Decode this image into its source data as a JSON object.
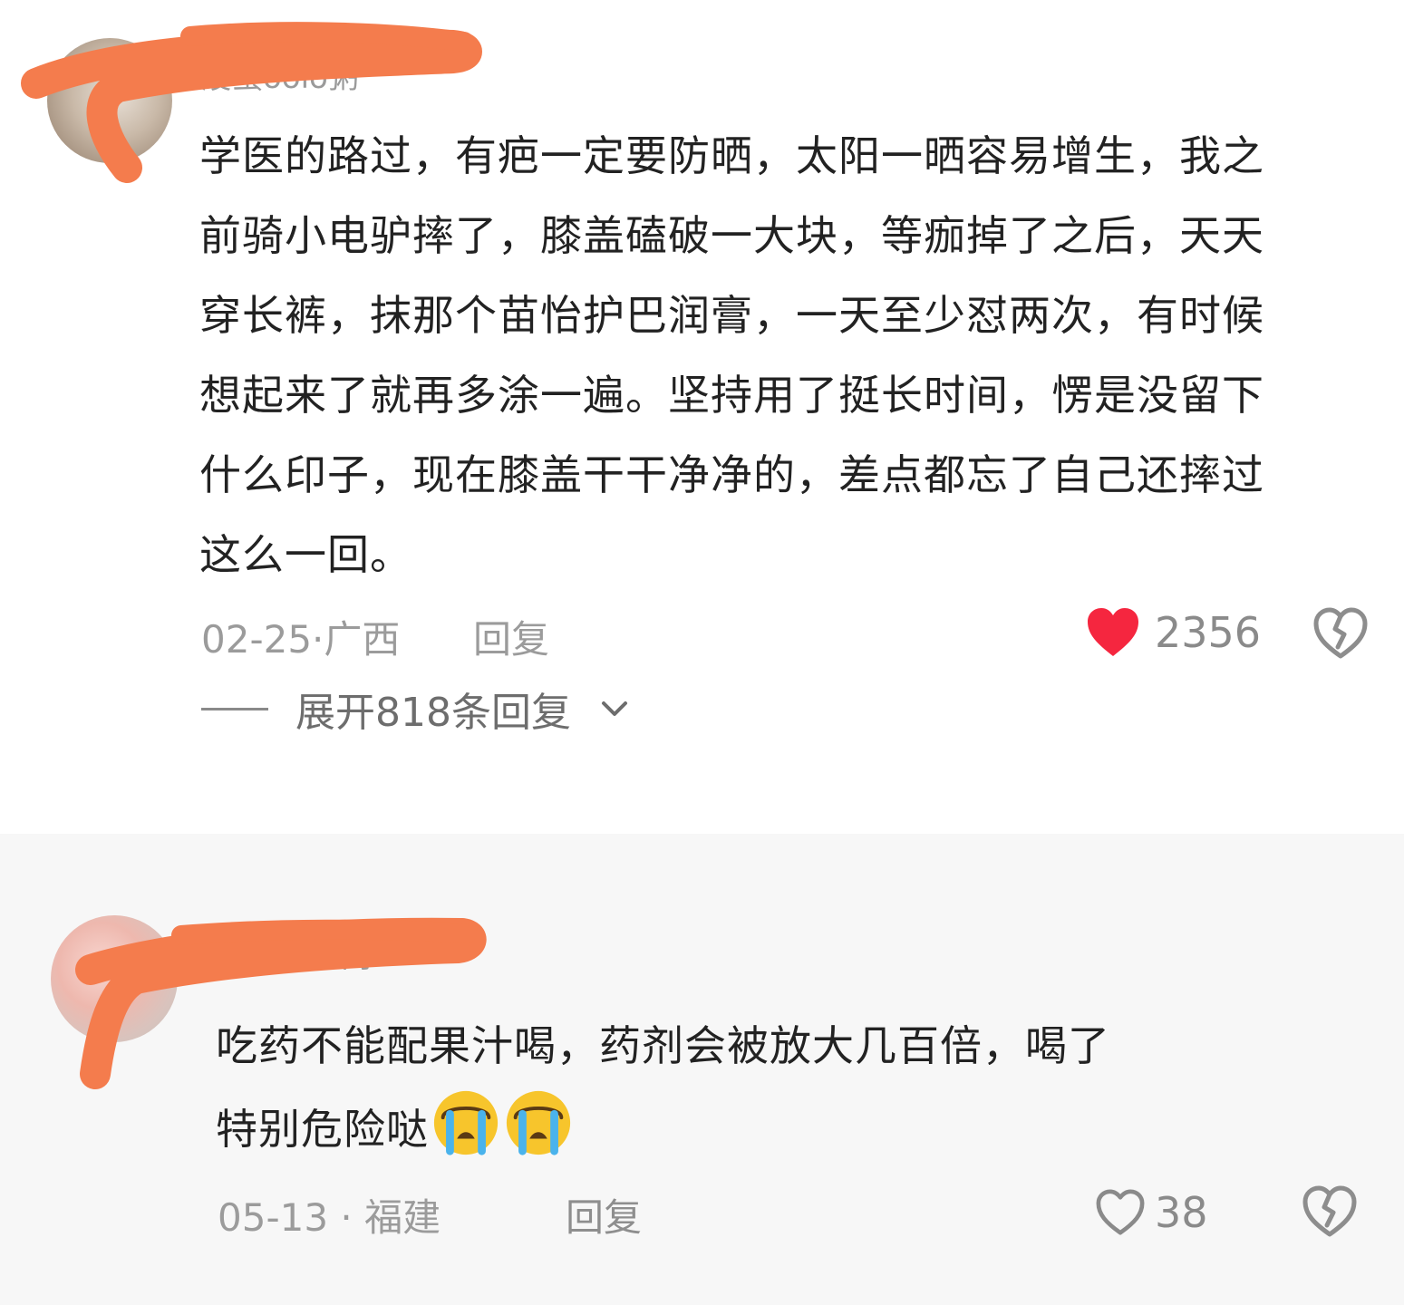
{
  "comments": [
    {
      "username": "废蛋oolo粥",
      "text_lines": [
        "学医的路过，有疤一定要防晒，太阳一晒容易增生，我之",
        "前骑小电驴摔了，膝盖磕破一大块，等痂掉了之后，天天",
        "穿长裤，抹那个苗怡护巴润膏，一天至少怼两次，有时候",
        "想起来了就再多涂一遍。坚持用了挺长时间，愣是没留下",
        "什么印子，现在膝盖干干净净的，差点都忘了自己还摔过",
        "这么一回。"
      ],
      "date_location": "02-25·广西",
      "reply_label": "回复",
      "like_count": "2356",
      "liked": true,
      "like_icon": "heart-filled-icon",
      "dislike_icon": "broken-heart-icon",
      "expand_label": "展开818条回复"
    },
    {
      "username": "是熊不是肉",
      "text_lines": [
        "吃药不能配果汁喝，药剂会被放大几百倍，喝了",
        "特别危险哒"
      ],
      "emoji": [
        "crying-face-icon",
        "crying-face-icon"
      ],
      "date_location": "05-13 · 福建",
      "reply_label": "回复",
      "like_count": "38",
      "liked": false,
      "like_icon": "heart-outline-icon",
      "dislike_icon": "broken-heart-icon"
    }
  ],
  "colors": {
    "like_red": "#f5263f",
    "redaction_orange": "#f47c4d",
    "text": "#222222",
    "meta_gray": "#9b9b9b"
  }
}
